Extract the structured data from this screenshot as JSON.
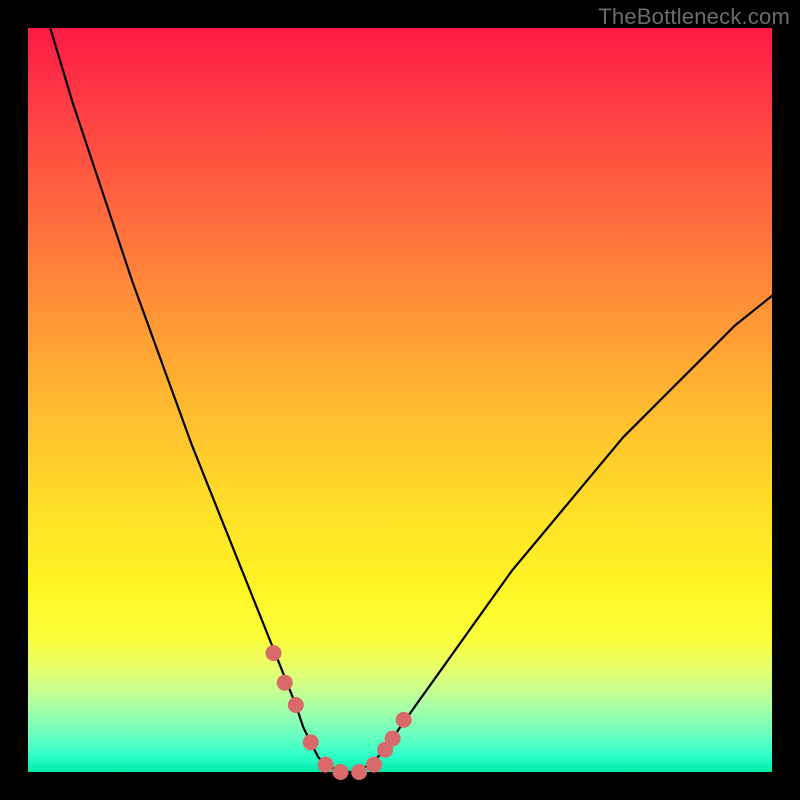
{
  "watermark": "TheBottleneck.com",
  "colors": {
    "curve": "#000000",
    "marker": "#d86a6a",
    "frame_bg_top": "#ff1a44",
    "frame_bg_bottom": "#00e8a8",
    "page_bg": "#000000"
  },
  "chart_data": {
    "type": "line",
    "title": "",
    "xlabel": "",
    "ylabel": "",
    "xlim": [
      0,
      100
    ],
    "ylim": [
      0,
      100
    ],
    "grid": false,
    "series": [
      {
        "name": "bottleneck-curve",
        "x": [
          3,
          6,
          10,
          14,
          18,
          22,
          26,
          28,
          30,
          32,
          34,
          36,
          37,
          38,
          39,
          40,
          42,
          44,
          46,
          48,
          50,
          55,
          60,
          65,
          70,
          75,
          80,
          85,
          90,
          95,
          100
        ],
        "y": [
          100,
          90,
          78,
          66,
          55,
          44,
          34,
          29,
          24,
          19,
          14,
          9,
          6,
          4,
          2,
          1,
          0,
          0,
          1,
          3,
          6,
          13,
          20,
          27,
          33,
          39,
          45,
          50,
          55,
          60,
          64
        ]
      }
    ],
    "markers": [
      {
        "name": "highlight-points",
        "x": [
          33,
          34.5,
          36,
          38,
          40,
          42,
          44.5,
          46.5,
          48,
          49,
          50.5
        ],
        "y": [
          16,
          12,
          9,
          4,
          1,
          0,
          0,
          1,
          3,
          4.5,
          7
        ]
      }
    ]
  }
}
